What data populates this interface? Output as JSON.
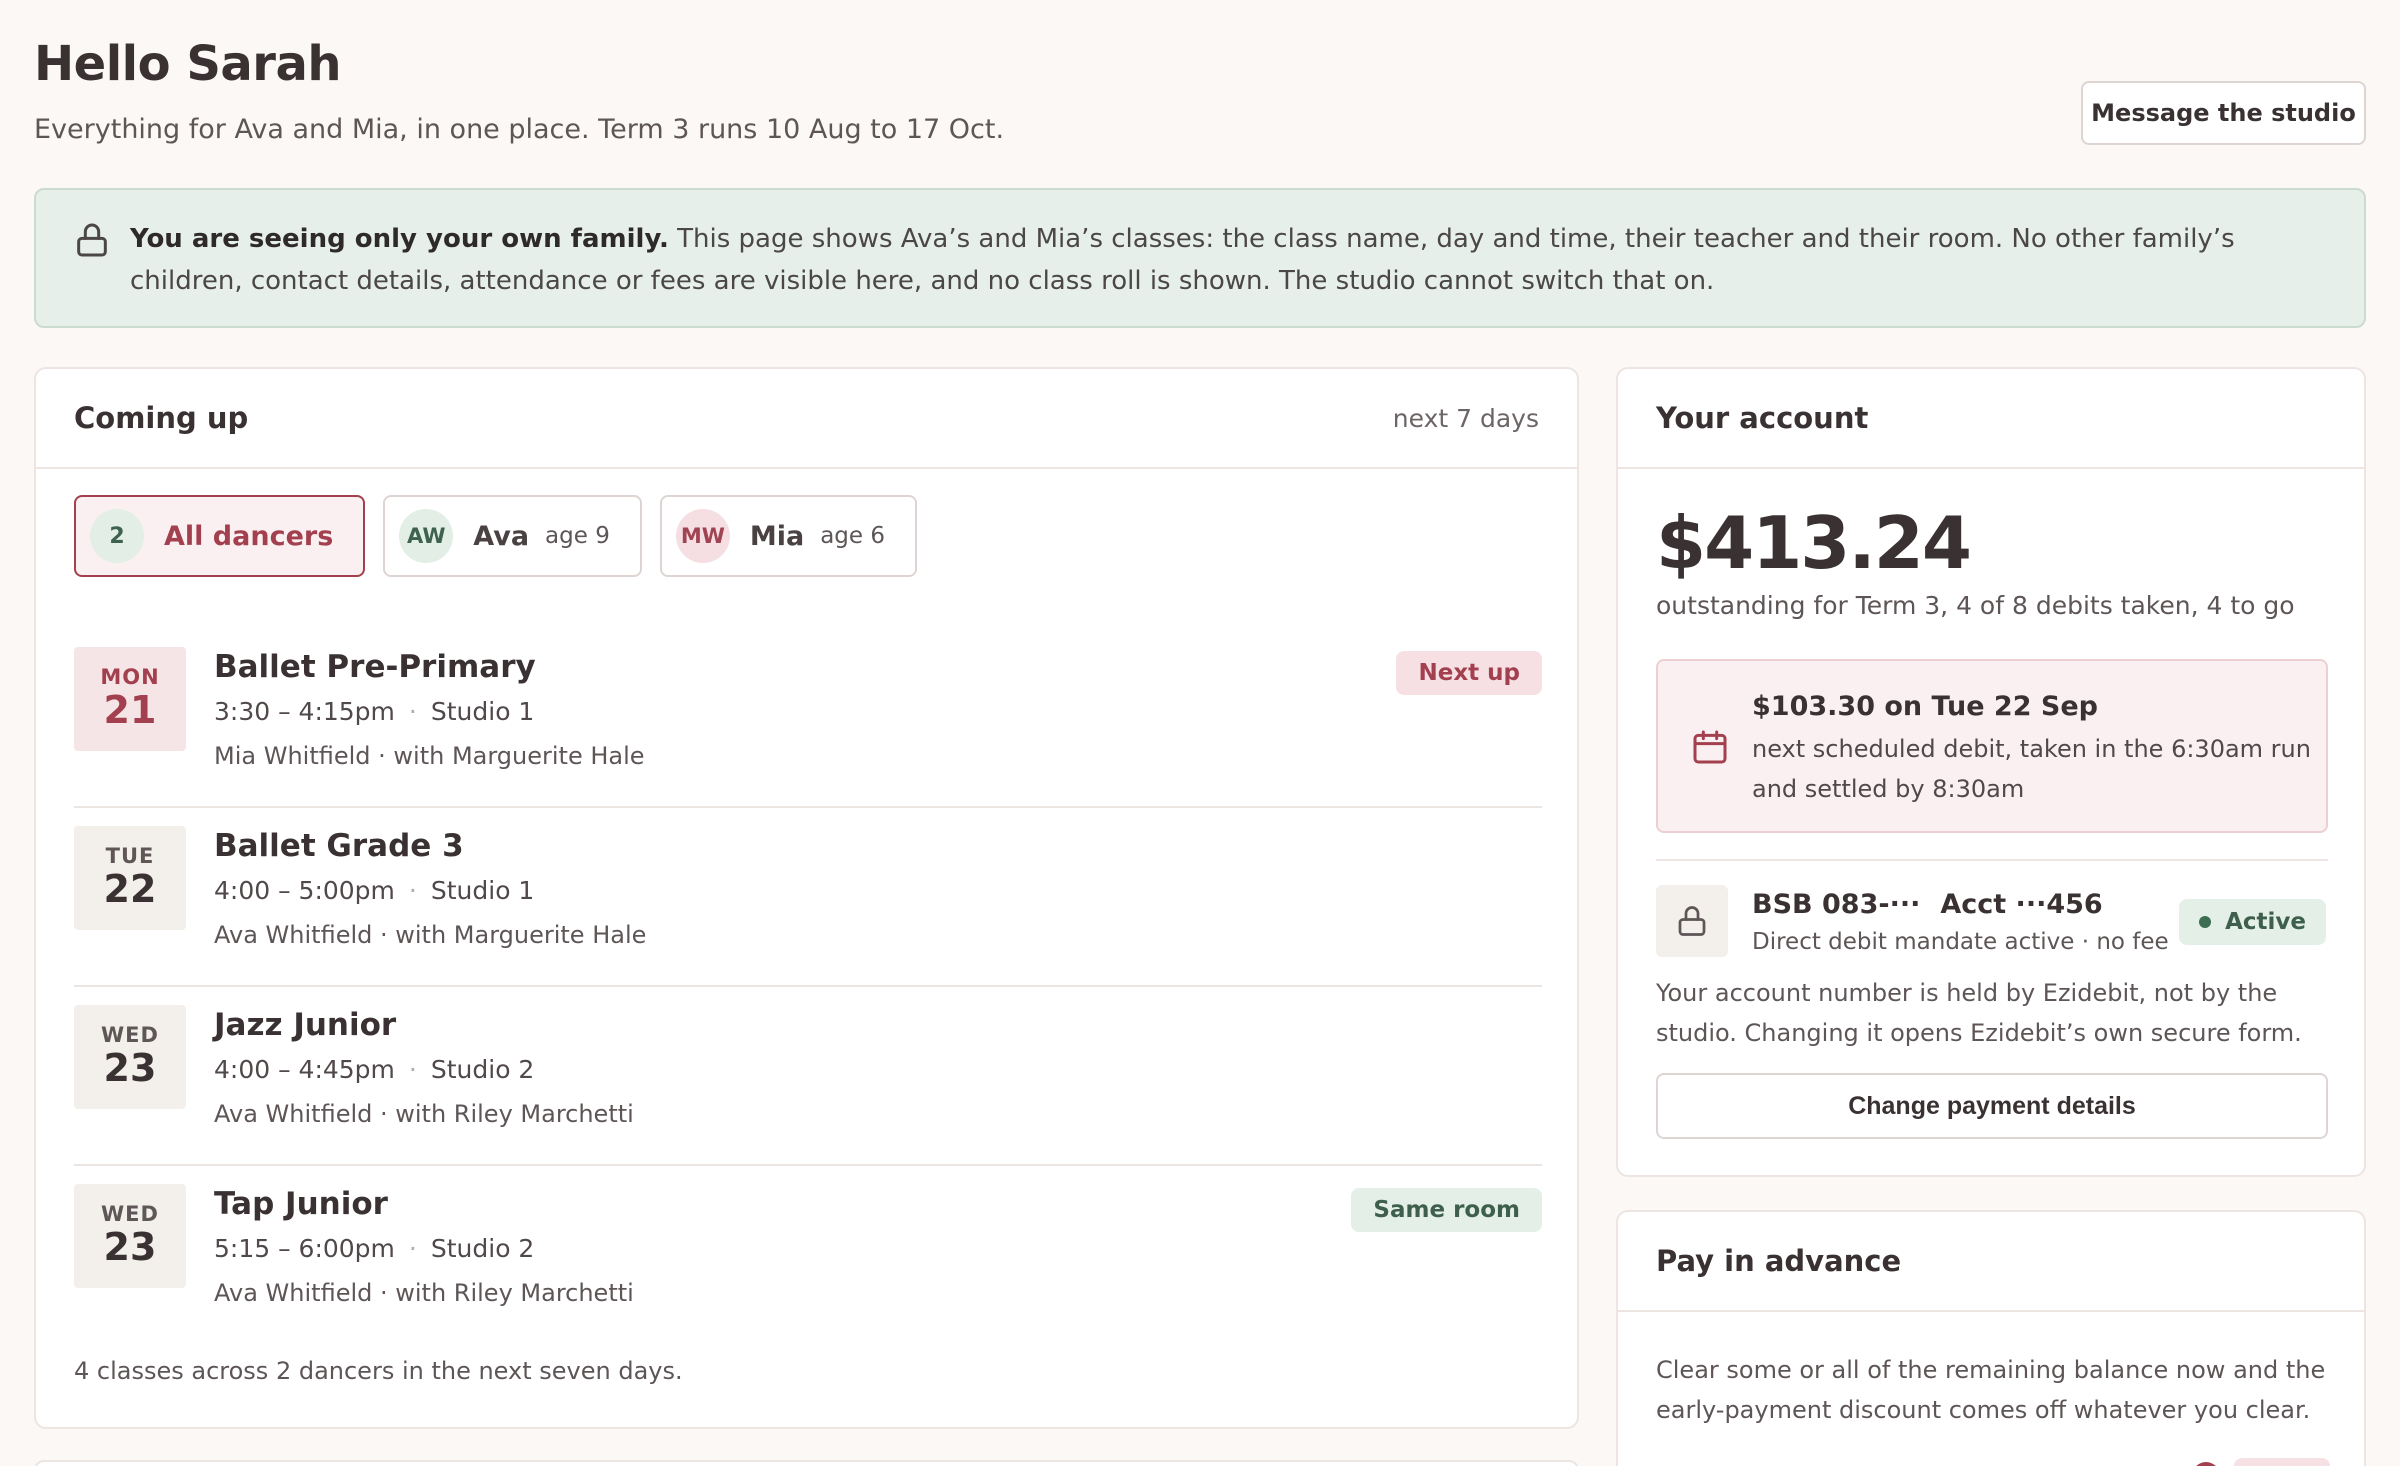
{
  "header": {
    "greeting": "Hello Sarah",
    "subtitle": "Everything for Ava and Mia, in one place. Term 3 runs 10 Aug to 17 Oct.",
    "message_button": "Message the studio"
  },
  "privacy_notice": {
    "icon": "lock-icon",
    "bold": "You are seeing only your own family.",
    "text": " This page shows Ava’s and Mia’s classes: the class name, day and time, their teacher and their room. No other family’s children, contact details, attendance or fees are visible here, and no class roll is shown. The studio cannot switch that on."
  },
  "coming_up": {
    "title": "Coming up",
    "range": "next 7 days",
    "filters": [
      {
        "badge": "2",
        "label": "All dancers",
        "age": "",
        "active": true
      },
      {
        "badge": "AW",
        "label": "Ava",
        "age": "age 9",
        "active": false
      },
      {
        "badge": "MW",
        "label": "Mia",
        "age": "age 6",
        "active": false
      }
    ],
    "classes": [
      {
        "dow": "MON",
        "day": "21",
        "name": "Ballet Pre-Primary",
        "time": "3:30 – 4:15pm",
        "room": "Studio 1",
        "who": "Mia Whitfield · with Marguerite Hale",
        "badge": "Next up"
      },
      {
        "dow": "TUE",
        "day": "22",
        "name": "Ballet Grade 3",
        "time": "4:00 – 5:00pm",
        "room": "Studio 1",
        "who": "Ava Whitfield · with Marguerite Hale",
        "badge": ""
      },
      {
        "dow": "WED",
        "day": "23",
        "name": "Jazz Junior",
        "time": "4:00 – 4:45pm",
        "room": "Studio 2",
        "who": "Ava Whitfield · with Riley Marchetti",
        "badge": ""
      },
      {
        "dow": "WED",
        "day": "23",
        "name": "Tap Junior",
        "time": "5:15 – 6:00pm",
        "room": "Studio 2",
        "who": "Ava Whitfield · with Riley Marchetti",
        "badge": "Same room"
      }
    ],
    "footer": "4 classes across 2 dancers in the next seven days."
  },
  "account": {
    "title": "Your account",
    "amount": "$413.24",
    "amount_sub": "outstanding for Term 3, 4 of 8 debits taken, 4 to go",
    "next_debit": {
      "icon": "calendar-icon",
      "title": "$103.30 on Tue 22 Sep",
      "desc": "next scheduled debit, taken in the 6:30am run and settled by 8:30am"
    },
    "bank": {
      "icon": "lock-icon",
      "bsb": "BSB 083-···",
      "acct": "Acct ···456",
      "sub": "Direct debit mandate active · no fee",
      "status": "Active"
    },
    "note": "Your account number is held by Ezidebit, not by the studio. Changing it opens Ezidebit’s own secure form.",
    "change_button": "Change payment details"
  },
  "advance": {
    "title": "Pay in advance",
    "text": "Clear some or all of the remaining balance now and the early-payment discount comes off whatever you clear."
  },
  "colors": {
    "accent": "#a3404f",
    "success": "#3d5f4c",
    "background": "#fcf8f6"
  }
}
